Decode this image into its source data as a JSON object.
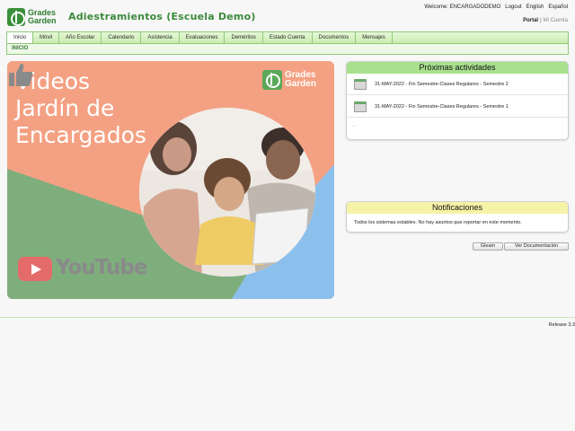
{
  "header": {
    "logo_line1": "Grades",
    "logo_line2": "Garden",
    "site_title": "Adiestramientos (Escuela Demo)",
    "welcome": "Welcome: ENCARGADODEMO",
    "logout": "Logout",
    "english": "English",
    "espanol": "Español",
    "portal": "Portal",
    "separator": "|",
    "mi_cuenta": "Mi Cuenta"
  },
  "nav": {
    "items": [
      "Inicio",
      "Móvil",
      "Año Escolar",
      "Calendario",
      "Asistencia",
      "Evaluaciones",
      "Deméritos",
      "Estado Cuenta",
      "Documentos",
      "Mensajes"
    ],
    "breadcrumb": "INICIO"
  },
  "banner": {
    "title_line1": "Videos",
    "title_line2": "Jardín de",
    "title_line3": "Encargados",
    "logo_line1": "Grades",
    "logo_line2": "Garden",
    "youtube": "YouTube"
  },
  "activities": {
    "title": "Próximas actividades",
    "items": [
      "31-MAY-2022 - Fin Semestre-Clases Regulares - Semestre 2",
      "31-MAY-2022 - Fin Semestre-Clases Regulares - Semestre 1"
    ],
    "footer_dot": "."
  },
  "notifications": {
    "title": "Notificaciones",
    "message": "Todos los sistemas estables. No hay asuntos que reportar en este momento."
  },
  "buttons": {
    "gleam": "Gleam",
    "docs": "Ver Documentación"
  },
  "footer": {
    "release": "Release 3.3"
  },
  "colors": {
    "nav_green": "#c9ecb0",
    "activities_header": "#a8e08e",
    "notifications_header": "#f6f3a8",
    "banner_peach": "#f4a183",
    "banner_green": "#7fae7d",
    "banner_blue": "#8cc0ec"
  }
}
